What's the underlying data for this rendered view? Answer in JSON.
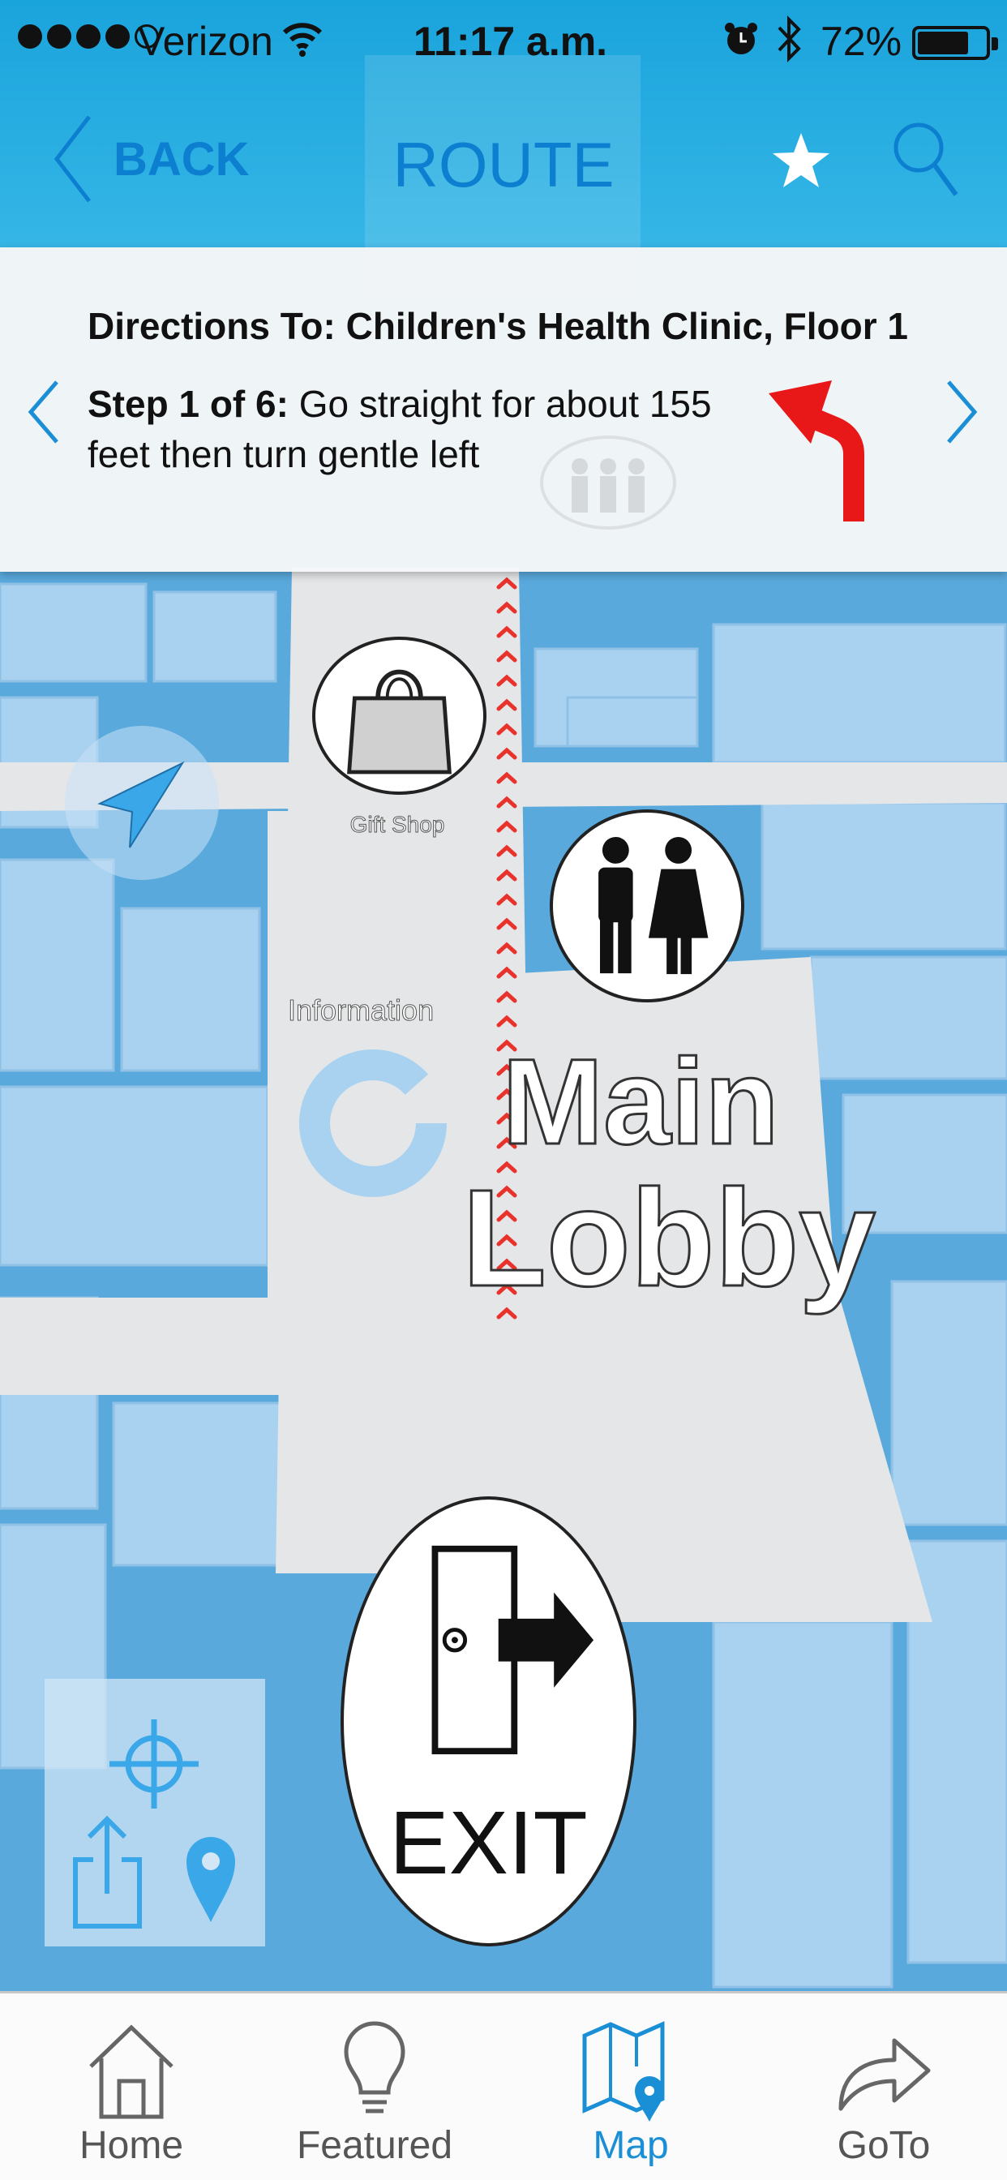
{
  "status_bar": {
    "carrier": "Verizon",
    "time": "11:17 a.m.",
    "battery_percent": "72%",
    "battery_level": 0.72,
    "signal_bars": 4
  },
  "nav": {
    "back_label": "BACK",
    "title": "ROUTE",
    "icons": [
      "chevron-left-icon",
      "star-icon",
      "search-icon"
    ]
  },
  "directions": {
    "destination": "Directions To: Children's Health Clinic, Floor 1",
    "step_label": "Step 1 of 6:",
    "step_text": " Go straight for about 155 feet then turn gentle left",
    "turn_icon": "turn-left-arrow-icon"
  },
  "map": {
    "gift_shop_label": "Gift Shop",
    "information_label": "Information",
    "lobby_line1": "Main",
    "lobby_line2": "Lobby",
    "exit_label": "EXIT",
    "route_color": "#e8322b",
    "building_color": "#a9d1f0",
    "floor_color": "#e4e6e8",
    "tools": [
      "crosshair-icon",
      "share-icon",
      "map-pin-icon"
    ]
  },
  "tabbar": {
    "tabs": [
      {
        "label": "Home",
        "icon": "home-icon",
        "active": false
      },
      {
        "label": "Featured",
        "icon": "lightbulb-icon",
        "active": false
      },
      {
        "label": "Map",
        "icon": "map-icon",
        "active": true
      },
      {
        "label": "GoTo",
        "icon": "forward-arrow-icon",
        "active": false
      }
    ],
    "accent": "#1b8fd6"
  }
}
